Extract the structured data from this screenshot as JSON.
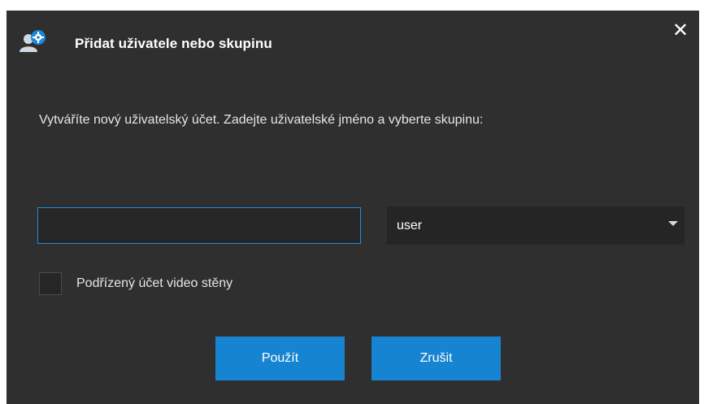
{
  "dialog": {
    "title": "Přidat uživatele nebo skupinu",
    "close_glyph": "✕",
    "icon": "user-gear-icon"
  },
  "message": "Vytváříte nový uživatelský účet. Zadejte uživatelské jméno a vyberte skupinu:",
  "username_input": {
    "value": "",
    "placeholder": ""
  },
  "group_select": {
    "selected": "user"
  },
  "checkbox": {
    "label": "Podřízený účet video stěny",
    "checked": false
  },
  "buttons": {
    "apply": "Použít",
    "cancel": "Zrušit"
  },
  "colors": {
    "background": "#2f2f2f",
    "accent": "#1684d0",
    "input_focus_border": "#1e8fe0"
  }
}
